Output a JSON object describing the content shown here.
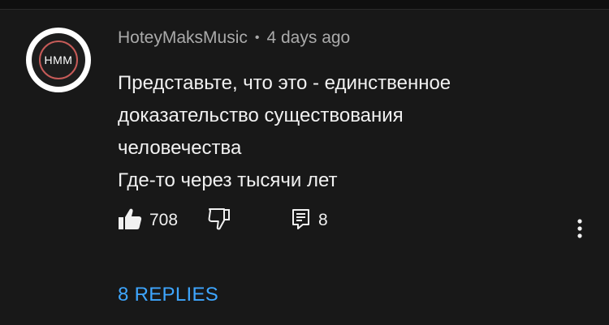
{
  "comment": {
    "avatar_text": "HMM",
    "author": "HoteyMaksMusic",
    "separator": "•",
    "time": "4 days ago",
    "lines": [
      "Представьте, что это - единственное",
      "доказательство существования",
      "человечества",
      "Где-то через тысячи лет"
    ],
    "like_count": "708",
    "reply_count": "8",
    "replies_label": "8 REPLIES"
  },
  "icons": {
    "like": "thumb-up-icon",
    "dislike": "thumb-down-icon",
    "reply": "comment-reply-icon",
    "more": "more-vert-icon"
  },
  "colors": {
    "background": "#181818",
    "text": "#f1f1f1",
    "secondary_text": "#aaaaaa",
    "link": "#3ea6ff",
    "avatar_ring": "#c65b58"
  }
}
